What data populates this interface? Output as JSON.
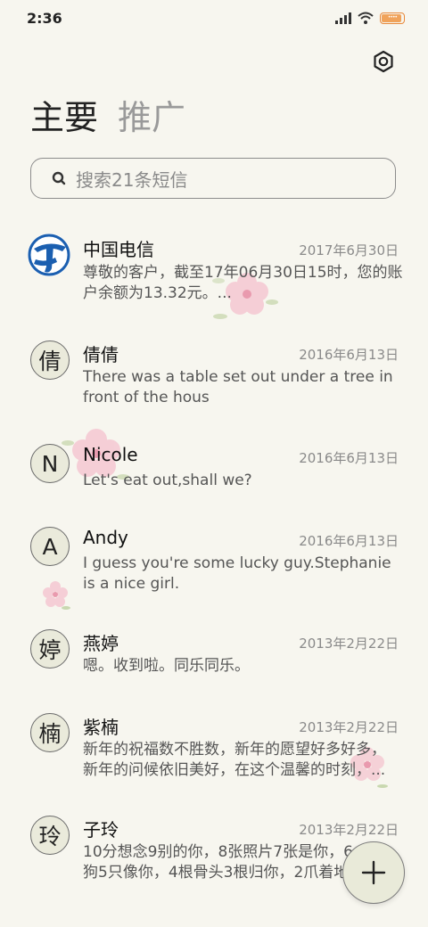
{
  "status_bar": {
    "time": "2:36",
    "battery_dots": "••••"
  },
  "tabs": {
    "primary": "主要",
    "promo": "推广"
  },
  "search": {
    "placeholder": "搜索21条短信"
  },
  "conversations": [
    {
      "name": "中国电信",
      "avatar": "",
      "date": "2017年6月30日",
      "preview": "尊敬的客户，截至17年06月30日15时，您的账\n户余额为13.32元。..."
    },
    {
      "name": "倩倩",
      "avatar": "倩",
      "date": "2016年6月13日",
      "preview": "There was a table set out under a tree in\nfront of the hous"
    },
    {
      "name": "Nicole",
      "avatar": "N",
      "date": "2016年6月13日",
      "preview": "Let's eat out,shall we?"
    },
    {
      "name": "Andy",
      "avatar": "A",
      "date": "2016年6月13日",
      "preview": "I guess you're some lucky guy.Stephanie\nis a nice girl."
    },
    {
      "name": "燕婷",
      "avatar": "婷",
      "date": "2013年2月22日",
      "preview": "嗯。收到啦。同乐同乐。"
    },
    {
      "name": "紫楠",
      "avatar": "楠",
      "date": "2013年2月22日",
      "preview": "新年的祝福数不胜数，新年的愿望好多好多，\n新年的问候依旧美好，在这个温馨的时刻，..."
    },
    {
      "name": "子玲",
      "avatar": "玲",
      "date": "2013年2月22日",
      "preview": "10分想念9别的你，8张照片7张是你，6\n狗5只像你，4根骨头3根归你，2爪着地"
    }
  ],
  "colors": {
    "background": "#f7f6ef",
    "accent_blue": "#1b5fb0",
    "flower_pink": "#f5c8d2"
  }
}
